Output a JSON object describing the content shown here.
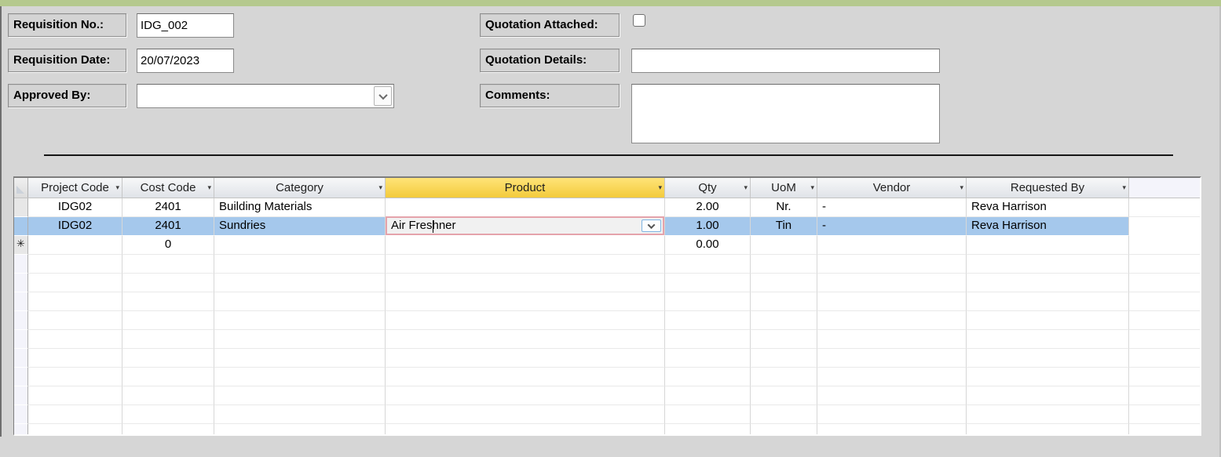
{
  "window": {
    "accent_color": "#b5c98e",
    "background_color": "#d6d6d6"
  },
  "form": {
    "requisition_no": {
      "label": "Requisition No.:",
      "value": "IDG_002"
    },
    "requisition_date": {
      "label": "Requisition Date:",
      "value": "20/07/2023"
    },
    "approved_by": {
      "label": "Approved By:",
      "value": ""
    },
    "quotation_attached": {
      "label": "Quotation Attached:",
      "checked": false
    },
    "quotation_details": {
      "label": "Quotation Details:",
      "value": ""
    },
    "comments": {
      "label": "Comments:",
      "value": ""
    }
  },
  "icons": {
    "filter_dropdown": "▾",
    "new_record": "✳"
  },
  "grid": {
    "headers": [
      "Project Code",
      "Cost Code",
      "Category",
      "Product",
      "Qty",
      "UoM",
      "Vendor",
      "Requested By"
    ],
    "highlighted_column": "Product",
    "selected_row_index": 1,
    "rows": [
      [
        "IDG02",
        "2401",
        "Building Materials",
        "",
        "2.00",
        "Nr.",
        "-",
        "Reva Harrison"
      ],
      [
        "IDG02",
        "2401",
        "Sundries",
        "Air Freshner",
        "1.00",
        "Tin",
        "-",
        "Reva Harrison"
      ],
      [
        "",
        "0",
        "",
        "",
        "0.00",
        "",
        "",
        ""
      ]
    ],
    "editing_cell": {
      "row": 1,
      "column": "Product",
      "value": "Air Freshner"
    },
    "colors": {
      "selected_row": "#a5c8ec",
      "current_record_selector": "#fbd65a",
      "highlighted_header": "#f3cb3c",
      "editing_cell_border": "#e5a3ab"
    }
  }
}
